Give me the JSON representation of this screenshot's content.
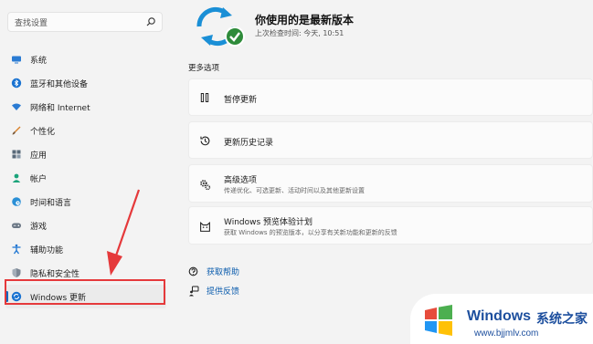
{
  "search": {
    "placeholder": "查找设置"
  },
  "sidebar": {
    "items": [
      {
        "label": "系统",
        "icon": "monitor-icon"
      },
      {
        "label": "蓝牙和其他设备",
        "icon": "bluetooth-icon"
      },
      {
        "label": "网络和 Internet",
        "icon": "wifi-icon"
      },
      {
        "label": "个性化",
        "icon": "brush-icon"
      },
      {
        "label": "应用",
        "icon": "apps-icon"
      },
      {
        "label": "帐户",
        "icon": "person-icon"
      },
      {
        "label": "时间和语言",
        "icon": "globe-clock-icon"
      },
      {
        "label": "游戏",
        "icon": "gamepad-icon"
      },
      {
        "label": "辅助功能",
        "icon": "accessibility-icon"
      },
      {
        "label": "隐私和安全性",
        "icon": "shield-icon"
      },
      {
        "label": "Windows 更新",
        "icon": "windows-update-icon",
        "selected": true
      }
    ]
  },
  "header": {
    "title": "你使用的是最新版本",
    "subtitle": "上次检查时间: 今天, 10:51"
  },
  "more_options": {
    "title": "更多选项",
    "cards": [
      {
        "title": "暂停更新",
        "icon": "pause-icon"
      },
      {
        "title": "更新历史记录",
        "icon": "history-icon"
      },
      {
        "title": "高级选项",
        "subtitle": "传递优化、可选更新、活动时间以及其他更新设置",
        "icon": "gears-icon"
      },
      {
        "title": "Windows 预览体验计划",
        "subtitle": "获取 Windows 的预览版本，以分享有关新功能和更新的反馈",
        "icon": "insider-cat-icon"
      }
    ]
  },
  "links": [
    {
      "label": "获取帮助",
      "icon": "help-icon"
    },
    {
      "label": "提供反馈",
      "icon": "feedback-icon"
    }
  ],
  "watermark": {
    "brand": "Windows",
    "cn": "系统之家",
    "url": "www.bjjmlv.com"
  },
  "colors": {
    "accent": "#0067c0",
    "annotation": "#e5393b",
    "check": "#2e8b3a",
    "sync": "#1a8fd6"
  }
}
